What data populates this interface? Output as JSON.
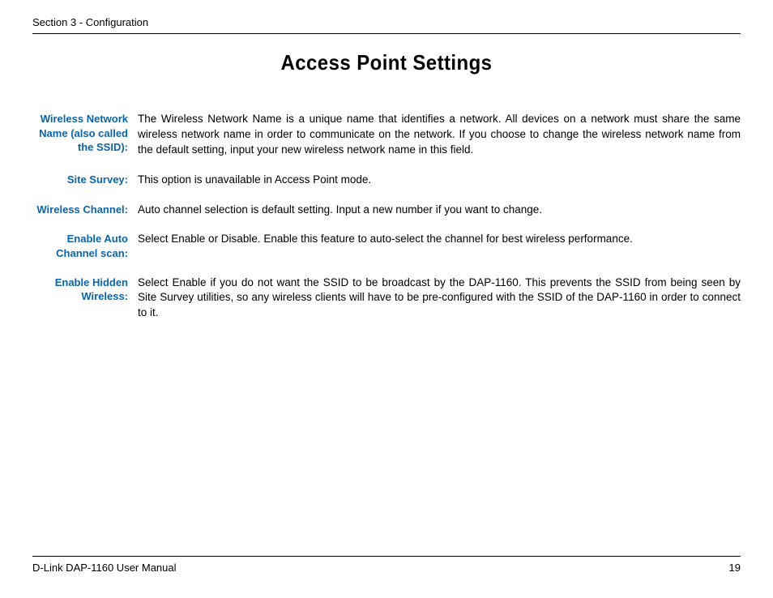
{
  "header": {
    "section": "Section 3 - Configuration"
  },
  "title": "Access Point Settings",
  "settings": [
    {
      "label": "Wireless Network Name (also called the SSID):",
      "description": "The Wireless Network Name is a unique name that identifies a network. All devices on a network must share the same wireless network name in order to communicate on the network. If you choose to change the wireless network name from the default setting, input your new wireless network name in this field."
    },
    {
      "label": "Site Survey:",
      "description": "This option is unavailable in Access Point mode."
    },
    {
      "label": "Wireless Channel:",
      "description": "Auto channel selection is default setting. Input a new number if you want to change."
    },
    {
      "label": "Enable Auto Channel scan:",
      "description": "Select Enable or Disable. Enable this feature to auto-select the channel for best wireless performance."
    },
    {
      "label": "Enable Hidden Wireless:",
      "description": "Select Enable if you do not want the SSID to be broadcast by the DAP-1160. This prevents the SSID from being seen by Site Survey utilities, so any wireless clients will have to be pre-configured with the SSID of the DAP-1160 in order to connect to it."
    }
  ],
  "footer": {
    "manual": "D-Link DAP-1160 User Manual",
    "page": "19"
  }
}
